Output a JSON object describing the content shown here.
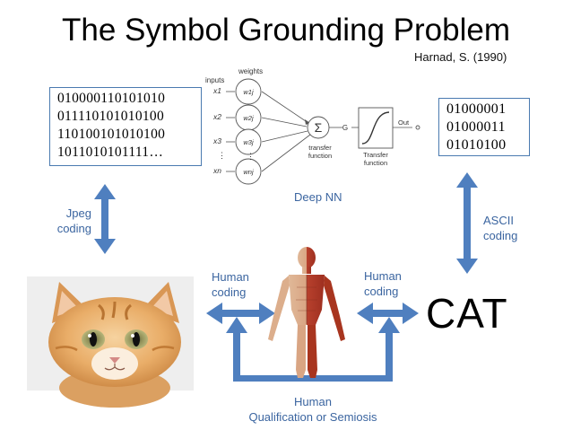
{
  "title": "The Symbol Grounding Problem",
  "citation": "Harnad, S. (1990)",
  "binary_left": [
    "010000110101010",
    "011110101010100",
    "110100101010100",
    "1011010101111…"
  ],
  "binary_right": [
    "01000001",
    "01000011",
    "01010100"
  ],
  "labels": {
    "jpeg": [
      "Jpeg",
      "coding"
    ],
    "ascii": [
      "ASCII",
      "coding"
    ],
    "human_left": [
      "Human",
      "coding"
    ],
    "human_right": [
      "Human",
      "coding"
    ],
    "human_bottom": [
      "Human",
      "Qualification or Semiosis"
    ],
    "deep_nn": "Deep NN",
    "cat": "CAT"
  },
  "neuron": {
    "inputs_label": "inputs",
    "weights_label": "weights",
    "inputs": [
      "x1",
      "x2",
      "x3",
      "xn"
    ],
    "weights": [
      "w1j",
      "w2j",
      "w3j",
      "wnj"
    ],
    "sum": "Σ",
    "net": "G",
    "transfer_label": [
      "transfer",
      "function"
    ],
    "activation_label": [
      "Transfer",
      "function"
    ],
    "out": "Out"
  },
  "images": {
    "left": "kitten-photo",
    "center": "human-anatomy-figure"
  },
  "colors": {
    "arrow": "#4f7fbf",
    "label": "#3b65a0",
    "box_border": "#4a7ab0"
  }
}
